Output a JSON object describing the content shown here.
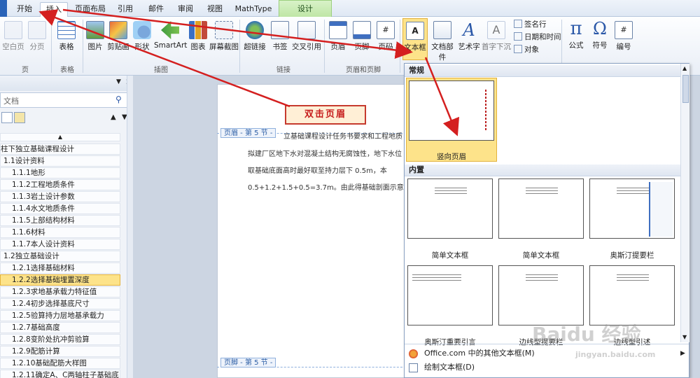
{
  "tabs": [
    "开始",
    "插入",
    "页面布局",
    "引用",
    "邮件",
    "审阅",
    "视图",
    "MathType",
    "设计"
  ],
  "ribbon": {
    "page_group": {
      "items": [
        "空白页",
        "分页"
      ],
      "label": "页"
    },
    "table_group": {
      "items": [
        "表格"
      ],
      "label": "表格"
    },
    "illus_group": {
      "items": [
        "图片",
        "剪贴画",
        "形状",
        "SmartArt",
        "图表",
        "屏幕截图"
      ],
      "label": "插图"
    },
    "links_group": {
      "items": [
        "超链接",
        "书签",
        "交叉引用"
      ],
      "label": "链接"
    },
    "hf_group": {
      "items": [
        "页眉",
        "页脚",
        "页码"
      ],
      "label": "页眉和页脚"
    },
    "text_group": {
      "items": [
        "文本框",
        "文档部件",
        "艺术字",
        "首字下沉"
      ],
      "small": [
        "签名行",
        "日期和时间",
        "对象"
      ]
    },
    "symbol_group": {
      "items": [
        "公式",
        "符号",
        "编号"
      ]
    }
  },
  "nav": {
    "search_placeholder": "文档",
    "items": [
      "柱下独立基础课程设计",
      "1.1设计资料",
      "1.1.1地形",
      "1.1.2工程地质条件",
      "1.1.3岩土设计参数",
      "1.1.4水文地质条件",
      "1.1.5上部结构材料",
      "1.1.6材料",
      "1.1.7本人设计资料",
      "1.2独立基础设计",
      "1.2.1选择基础材料",
      "1.2.2选择基础埋置深度",
      "1.2.3求地基承载力特征值",
      "1.2.4初步选择基底尺寸",
      "1.2.5验算持力层地基承载力",
      "1.2.7基础高度",
      "1.2.8变阶处抗冲剪验算",
      "1.2.9配筋计算",
      "1.2.10基础配筋大样图",
      "1.2.11确定A、C两轴柱子基础底..."
    ],
    "selected": "1.2.2选择基础埋置深度"
  },
  "doc": {
    "header_label": "页眉 - 第 5 节 -",
    "footer_label": "页脚 - 第 5 节 -",
    "lines": [
      "立基础课程设计任务书要求和工程地质",
      "拟建厂区地下水对混凝土结构无腐蚀性，地下水位",
      "取基础底面高时最好取至持力层下 0.5m，本",
      "0.5+1.2+1.5+0.5=3.7m。由此得基础剖面示意图"
    ]
  },
  "annotation": "双击页眉",
  "gallery": {
    "section_general": "常规",
    "general_item": "竖向页眉",
    "section_builtin": "内置",
    "items": [
      "简单文本框",
      "简单文本框",
      "奥斯汀提要栏",
      "奥斯汀重要引言",
      "边线型提要栏",
      "边线型引述"
    ],
    "menu": [
      "Office.com 中的其他文本框(M)",
      "绘制文本框(D)"
    ]
  },
  "watermark": {
    "logo": "Baidu经验",
    "url": "jingyan.baidu.com"
  },
  "colors": {
    "arrow": "#d41f1f",
    "highlight": "#fde38a"
  }
}
